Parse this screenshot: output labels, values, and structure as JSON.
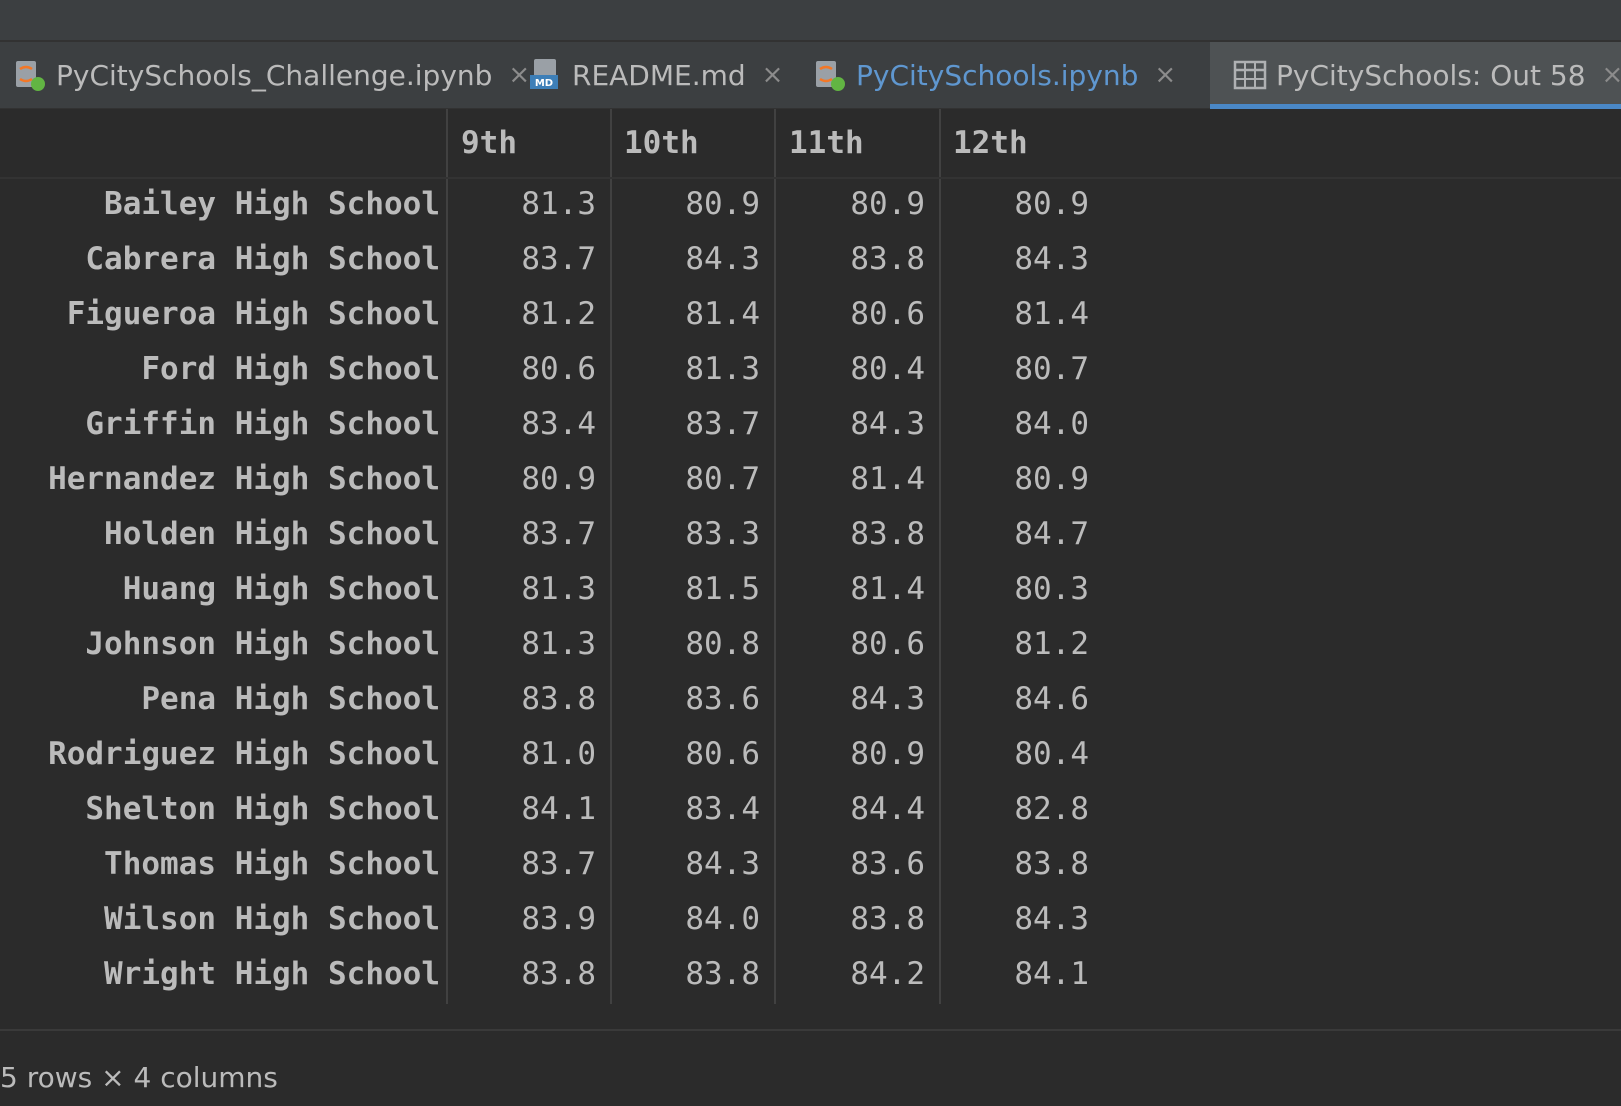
{
  "tabs": [
    {
      "label": "PyCitySchools_Challenge.ipynb",
      "icon": "jupyter-notebook-icon",
      "closable": true,
      "active": false
    },
    {
      "label": "README.md",
      "icon": "markdown-file-icon",
      "closable": true,
      "active": false
    },
    {
      "label": "PyCitySchools.ipynb",
      "icon": "jupyter-notebook-icon",
      "closable": true,
      "active": false
    },
    {
      "label": "PyCitySchools: Out 58",
      "icon": "table-icon",
      "closable": true,
      "active": true
    }
  ],
  "close_glyph": "×",
  "table": {
    "columns": [
      "9th",
      "10th",
      "11th",
      "12th"
    ],
    "rows": [
      {
        "label": "Bailey High School",
        "values": [
          "81.3",
          "80.9",
          "80.9",
          "80.9"
        ]
      },
      {
        "label": "Cabrera High School",
        "values": [
          "83.7",
          "84.3",
          "83.8",
          "84.3"
        ]
      },
      {
        "label": "Figueroa High School",
        "values": [
          "81.2",
          "81.4",
          "80.6",
          "81.4"
        ]
      },
      {
        "label": "Ford High School",
        "values": [
          "80.6",
          "81.3",
          "80.4",
          "80.7"
        ]
      },
      {
        "label": "Griffin High School",
        "values": [
          "83.4",
          "83.7",
          "84.3",
          "84.0"
        ]
      },
      {
        "label": "Hernandez High School",
        "values": [
          "80.9",
          "80.7",
          "81.4",
          "80.9"
        ]
      },
      {
        "label": "Holden High School",
        "values": [
          "83.7",
          "83.3",
          "83.8",
          "84.7"
        ]
      },
      {
        "label": "Huang High School",
        "values": [
          "81.3",
          "81.5",
          "81.4",
          "80.3"
        ]
      },
      {
        "label": "Johnson High School",
        "values": [
          "81.3",
          "80.8",
          "80.6",
          "81.2"
        ]
      },
      {
        "label": "Pena High School",
        "values": [
          "83.8",
          "83.6",
          "84.3",
          "84.6"
        ]
      },
      {
        "label": "Rodriguez High School",
        "values": [
          "81.0",
          "80.6",
          "80.9",
          "80.4"
        ]
      },
      {
        "label": "Shelton High School",
        "values": [
          "84.1",
          "83.4",
          "84.4",
          "82.8"
        ]
      },
      {
        "label": "Thomas High School",
        "values": [
          "83.7",
          "84.3",
          "83.6",
          "83.8"
        ]
      },
      {
        "label": "Wilson High School",
        "values": [
          "83.9",
          "84.0",
          "83.8",
          "84.3"
        ]
      },
      {
        "label": "Wright High School",
        "values": [
          "83.8",
          "83.8",
          "84.2",
          "84.1"
        ]
      }
    ]
  },
  "footer": {
    "summary": "5 rows × 4 columns"
  },
  "colors": {
    "background": "#2b2b2b",
    "tab_bar": "#3c3f41",
    "active_tab_underline": "#4a88c7",
    "link_tab_text": "#5f97d0",
    "text": "#bbbbbb"
  }
}
